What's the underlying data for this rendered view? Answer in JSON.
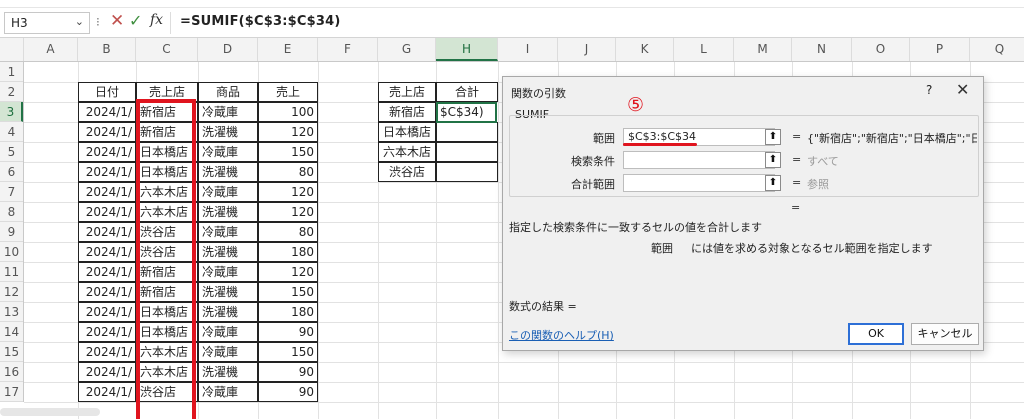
{
  "formula_bar": {
    "name_box": "H3",
    "formula": "=SUMIF($C$3:$C$34)"
  },
  "columns": [
    "A",
    "B",
    "C",
    "D",
    "E",
    "F",
    "G",
    "H",
    "I",
    "J",
    "K",
    "L",
    "M",
    "N",
    "O",
    "P",
    "Q"
  ],
  "rows": [
    "1",
    "2",
    "3",
    "4",
    "5",
    "6",
    "7",
    "8",
    "9",
    "10",
    "11",
    "12",
    "13",
    "14",
    "15",
    "16",
    "17"
  ],
  "selected": {
    "column": "H",
    "row": "3"
  },
  "table1": {
    "headers": [
      "日付",
      "売上店",
      "商品",
      "売上"
    ],
    "rows": [
      [
        "2024/1/",
        "新宿店",
        "冷蔵庫",
        "100"
      ],
      [
        "2024/1/",
        "新宿店",
        "洗濯機",
        "120"
      ],
      [
        "2024/1/",
        "日本橋店",
        "冷蔵庫",
        "150"
      ],
      [
        "2024/1/",
        "日本橋店",
        "洗濯機",
        "80"
      ],
      [
        "2024/1/",
        "六本木店",
        "冷蔵庫",
        "120"
      ],
      [
        "2024/1/",
        "六本木店",
        "洗濯機",
        "120"
      ],
      [
        "2024/1/",
        "渋谷店",
        "冷蔵庫",
        "80"
      ],
      [
        "2024/1/",
        "渋谷店",
        "洗濯機",
        "180"
      ],
      [
        "2024/1/",
        "新宿店",
        "冷蔵庫",
        "120"
      ],
      [
        "2024/1/",
        "新宿店",
        "洗濯機",
        "150"
      ],
      [
        "2024/1/",
        "日本橋店",
        "洗濯機",
        "180"
      ],
      [
        "2024/1/",
        "日本橋店",
        "冷蔵庫",
        "90"
      ],
      [
        "2024/1/",
        "六本木店",
        "冷蔵庫",
        "150"
      ],
      [
        "2024/1/",
        "六本木店",
        "洗濯機",
        "90"
      ],
      [
        "2024/1/",
        "渋谷店",
        "冷蔵庫",
        "90"
      ]
    ]
  },
  "table2": {
    "headers": [
      "売上店",
      "合計"
    ],
    "stores": [
      "新宿店",
      "日本橋店",
      "六本木店",
      "渋谷店"
    ],
    "h3_value": "$C$34)"
  },
  "dialog": {
    "title": "関数の引数",
    "help_q": "?",
    "close": "X",
    "annotation": "⑤",
    "function_name": "SUMIF",
    "args": [
      {
        "label": "範囲",
        "value": "$C$3:$C$34",
        "result": "{\"新宿店\";\"新宿店\";\"日本橋店\";\"日本",
        "muted": false
      },
      {
        "label": "検索条件",
        "value": "",
        "result": "すべて",
        "muted": true
      },
      {
        "label": "合計範囲",
        "value": "",
        "result": "参照",
        "muted": true
      }
    ],
    "eq": "=",
    "ref_icon": "⬆",
    "description": "指定した検索条件に一致するセルの値を合計します",
    "arg_desc_label": "範囲",
    "arg_desc": "には値を求める対象となるセル範囲を指定します",
    "result_label": "数式の結果 =",
    "help_link": "この関数のヘルプ(H)",
    "ok": "OK",
    "cancel": "キャンセル"
  },
  "colors": {
    "accent_green": "#217346",
    "annotation_red": "#e0141e",
    "ok_border": "#2d6fd6"
  }
}
